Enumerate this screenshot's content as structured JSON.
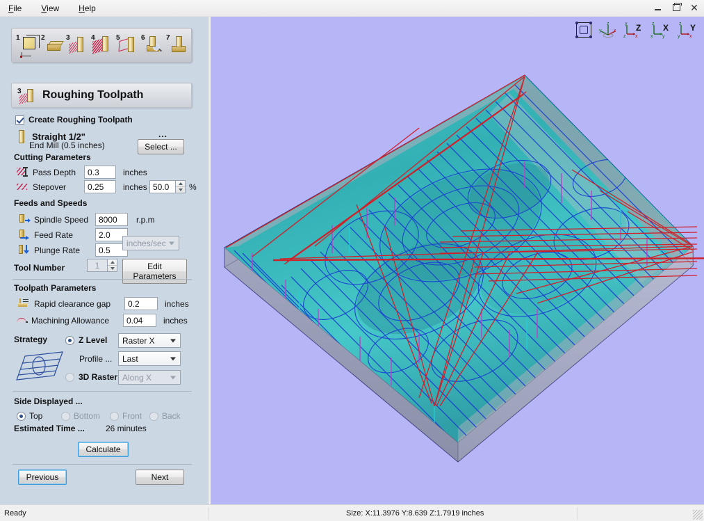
{
  "window": {
    "menus": [
      {
        "accel": "F",
        "rest": "ile"
      },
      {
        "accel": "V",
        "rest": "iew"
      },
      {
        "accel": "H",
        "rest": "elp"
      }
    ],
    "controls": {
      "minimize": "minimize-button",
      "maximize": "restore-button",
      "close": "close-button"
    }
  },
  "toolbar": {
    "steps": [
      {
        "number": "1",
        "name": "model-setup"
      },
      {
        "number": "2",
        "name": "material-setup"
      },
      {
        "number": "3",
        "name": "roughing-toolpath"
      },
      {
        "number": "4",
        "name": "finishing-toolpath"
      },
      {
        "number": "5",
        "name": "cutout-toolpath"
      },
      {
        "number": "6",
        "name": "preview-toolpath"
      },
      {
        "number": "7",
        "name": "save-toolpath"
      }
    ]
  },
  "panel": {
    "title": "Roughing Toolpath",
    "step_number": "3",
    "create_checkbox": {
      "label": "Create Roughing Toolpath",
      "checked": true
    },
    "tool": {
      "name": "Straight 1/2\"",
      "description": "End Mill (0.5 inches)",
      "ellipsis": "...",
      "select_button": "Select ..."
    },
    "cutting_parameters": {
      "heading": "Cutting Parameters",
      "pass_depth": {
        "label": "Pass Depth",
        "value": "0.3",
        "unit": "inches"
      },
      "stepover": {
        "label": "Stepover",
        "value": "0.25",
        "unit": "inches",
        "percent": "50.0",
        "percent_unit": "%"
      }
    },
    "feeds_and_speeds": {
      "heading": "Feeds and Speeds",
      "spindle_speed": {
        "label": "Spindle Speed",
        "value": "8000",
        "unit": "r.p.m"
      },
      "feed_rate": {
        "label": "Feed Rate",
        "value": "2.0"
      },
      "plunge_rate": {
        "label": "Plunge Rate",
        "value": "0.5"
      },
      "rate_units": "inches/sec",
      "tool_number": {
        "label": "Tool Number",
        "value": "1"
      },
      "edit_parameters_button": "Edit Parameters"
    },
    "toolpath_parameters": {
      "heading": "Toolpath Parameters",
      "rapid_clearance_gap": {
        "label": "Rapid clearance gap",
        "value": "0.2",
        "unit": "inches"
      },
      "machining_allowance": {
        "label": "Machining Allowance",
        "value": "0.04",
        "unit": "inches"
      }
    },
    "strategy": {
      "heading": "Strategy",
      "z_level": {
        "label": "Z Level",
        "selected": true,
        "dropdown": "Raster X"
      },
      "profile": {
        "label": "Profile ...",
        "dropdown": "Last"
      },
      "raster_3d": {
        "label": "3D Raster",
        "selected": false,
        "dropdown": "Along X"
      }
    },
    "side_displayed": {
      "heading": "Side Displayed ...",
      "options": [
        {
          "label": "Top",
          "selected": true,
          "enabled": true
        },
        {
          "label": "Bottom",
          "selected": false,
          "enabled": false
        },
        {
          "label": "Front",
          "selected": false,
          "enabled": false
        },
        {
          "label": "Back",
          "selected": false,
          "enabled": false
        }
      ]
    },
    "estimated_time": {
      "label": "Estimated Time ...",
      "value": "26 minutes"
    },
    "calculate_button": "Calculate",
    "previous_button": "Previous",
    "next_button": "Next"
  },
  "viewport": {
    "view_buttons": [
      {
        "name": "zoom-to-fit",
        "label": ""
      },
      {
        "name": "isometric-view",
        "label": ""
      },
      {
        "name": "z-axis-view",
        "label": "Z"
      },
      {
        "name": "x-axis-view",
        "label": "X"
      },
      {
        "name": "y-axis-view",
        "label": "Y"
      }
    ],
    "background_color": "#b6b6f7",
    "model_color": "#37b6b8",
    "toolpath_color": "#1a3fd0",
    "rapid_move_color": "#d0202a",
    "plunge_color": "#cc33cc"
  },
  "statusbar": {
    "ready": "Ready",
    "size": "Size: X:11.3976 Y:8.639 Z:1.7919 inches"
  }
}
